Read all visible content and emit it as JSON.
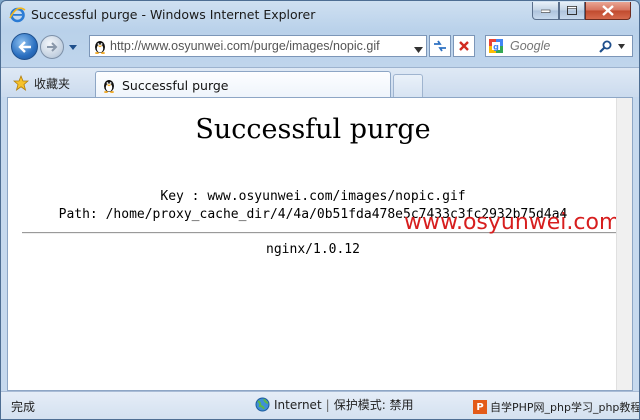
{
  "window": {
    "title": "Successful purge - Windows Internet Explorer"
  },
  "nav": {
    "address_value": "http://www.osyunwei.com/purge/images/nopic.gif",
    "search_placeholder": "Google"
  },
  "tabs": {
    "favorites_label": "收藏夹",
    "active_tab_label": "Successful purge"
  },
  "page": {
    "title": "Successful purge",
    "key_line": "Key : www.osyunwei.com/images/nopic.gif",
    "path_line": "Path: /home/proxy_cache_dir/4/4a/0b51fda478e5c7433c3fc2932b75d4a4",
    "server_line": "nginx/1.0.12",
    "watermark_site": "www.osyunwei.com"
  },
  "status": {
    "text": "完成",
    "zone_label": "Internet",
    "protected_mode": "保护模式: 禁用",
    "separator": "|"
  },
  "badge": {
    "logo_letter": "P",
    "text": "自学PHP网_php学习_php教程"
  },
  "colors": {
    "watermark": "#d71e1e",
    "php_badge": "#e35b1a"
  },
  "icons": {
    "app": "ie-icon",
    "back": "back-arrow-icon",
    "forward": "forward-arrow-icon",
    "address_site": "tencent-penguin-icon",
    "refresh": "refresh-icon",
    "stop": "stop-icon",
    "search_provider": "google-icon",
    "search_go": "magnifier-icon",
    "favorites": "star-icon",
    "tab_site": "tencent-penguin-icon",
    "zone": "globe-icon"
  }
}
